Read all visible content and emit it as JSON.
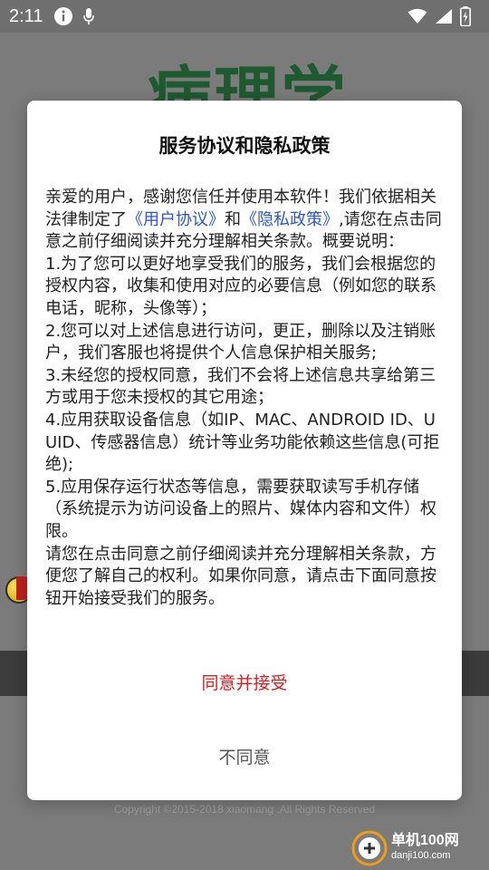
{
  "status_bar": {
    "time": "2:11",
    "icons": [
      "info-icon",
      "mic-icon",
      "wifi-icon",
      "signal-icon",
      "battery-icon"
    ]
  },
  "background": {
    "app_title": "病理学",
    "footer": "Copyright ©2015-2018 xiaomang .All Rights Reserved"
  },
  "dialog": {
    "title": "服务协议和隐私政策",
    "p1_a": "亲爱的用户，感谢您信任并使用本软件！我们依据相关法律制定了",
    "link_user": "《用户协议》",
    "p1_and": "和",
    "link_privacy": "《隐私政策》",
    "p1_b": ",请您在点击同意之前仔细阅读并充分理解相关条款。概要说明：",
    "item1": "1.为了您可以更好地享受我们的服务，我们会根据您的授权内容，收集和使用对应的必要信息（例如您的联系电话，昵称，头像等）；",
    "item2": "2.您可以对上述信息进行访问，更正，删除以及注销账户，我们客服也将提供个人信息保护相关服务;",
    "item3": "3.未经您的授权同意，我们不会将上述信息共享给第三方或用于您未授权的其它用途；",
    "item4": "4.应用获取设备信息（如IP、MAC、ANDROID ID、UUID、传感器信息）统计等业务功能依赖这些信息(可拒绝);",
    "item5": "5.应用保存运行状态等信息，需要获取读写手机存储（系统提示为访问设备上的照片、媒体内容和文件）权限。",
    "closing": "请您在点击同意之前仔细阅读并充分理解相关条款，方便您了解自己的权利。如果你同意，请点击下面同意按钮开始接受我们的服务。",
    "accept_label": "同意并接受",
    "reject_label": "不同意"
  },
  "watermark": {
    "main": "单机100网",
    "sub": "danji100.com"
  },
  "colors": {
    "accept": "#e21b1b",
    "link": "#2a55d4"
  }
}
